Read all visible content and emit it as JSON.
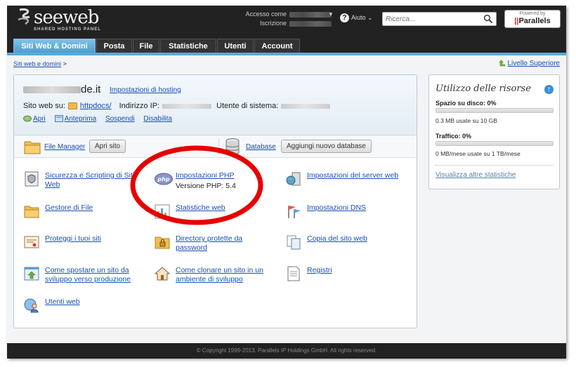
{
  "header": {
    "logo_text": "seeweb",
    "logo_sub": "SHARED HOSTING PANEL",
    "login_label": "Accesso come",
    "signup_label": "Iscrizione",
    "help_label": "Aiuto",
    "search_placeholder": "Ricerca...",
    "powered_by": "Powered by",
    "parallels": "Parallels"
  },
  "tabs": [
    {
      "label": "Siti Web & Domini",
      "active": true
    },
    {
      "label": "Posta"
    },
    {
      "label": "File"
    },
    {
      "label": "Statistiche"
    },
    {
      "label": "Utenti"
    },
    {
      "label": "Account"
    }
  ],
  "breadcrumb": {
    "link": "Siti web e domini",
    "sep": ">"
  },
  "level_up": "Livello Superiore",
  "domain": {
    "name_suffix": "de.it",
    "hosting_settings": "Impostazioni di hosting",
    "site_on_label": "Sito web su:",
    "site_folder": "httpdocs/",
    "ip_label": "Indirizzo IP:",
    "user_label": "Utente di sistema:",
    "actions": {
      "open": "Apri",
      "preview": "Anteprima",
      "suspend": "Sospendi",
      "disable": "Disabilita"
    }
  },
  "tools": {
    "file_manager": "File Manager",
    "open_site": "Apri sito",
    "database": "Database",
    "add_database": "Aggiungi nuovo database"
  },
  "items": {
    "security": "Sicurezza e Scripting di Siti Web",
    "php_settings": "Impostazioni PHP",
    "php_version": "Versione PHP: 5.4",
    "web_server": "Impostazioni del server web",
    "file_manager": "Gestore di File",
    "web_stats": "Statistiche web",
    "dns": "Impostazioni DNS",
    "protect": "Proteggi i tuoi siti",
    "protected_dirs": "Directory protette da password",
    "copy_site": "Copia del sito web",
    "move_site": "Come spostare un sito da sviluppo verso produzione",
    "clone_site": "Come clonare un sito in un ambiente di sviluppo",
    "logs": "Registri",
    "web_users": "Utenti web"
  },
  "resources": {
    "title": "Utilizzo delle risorse",
    "disk_label": "Spazio su disco: 0%",
    "disk_value": 0,
    "disk_detail": "0.3 MB usate su 10 GB",
    "traffic_label": "Traffico: 0%",
    "traffic_value": 0,
    "traffic_detail": "0 MB/mese usate su 1 TB/mese",
    "more_stats": "Visualizza altre statistiche"
  },
  "footer": "© Copyright 1999-2013. Parallels IP Holdings GmbH. All rights reserved.",
  "colors": {
    "accent": "#4a9fd0",
    "header_bg": "#222222",
    "link": "#1a4fb0",
    "annotation": "#e60000"
  }
}
